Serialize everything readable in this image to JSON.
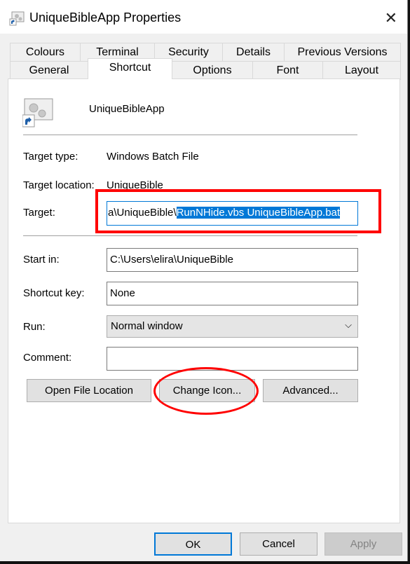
{
  "window": {
    "title": "UniqueBibleApp Properties"
  },
  "tabs_row1": [
    "Colours",
    "Terminal",
    "Security",
    "Details",
    "Previous Versions"
  ],
  "tabs_row2": [
    "General",
    "Shortcut",
    "Options",
    "Font",
    "Layout"
  ],
  "shortcut": {
    "name": "UniqueBibleApp",
    "target_type_label": "Target type:",
    "target_type": "Windows Batch File",
    "target_location_label": "Target location:",
    "target_location": "UniqueBible",
    "target_label": "Target:",
    "target_prefix": "a\\UniqueBible\\",
    "target_selected": "RunNHide.vbs UniqueBibleApp.bat",
    "start_in_label": "Start in:",
    "start_in": "C:\\Users\\elira\\UniqueBible",
    "shortcut_key_label": "Shortcut key:",
    "shortcut_key": "None",
    "run_label": "Run:",
    "run": "Normal window",
    "comment_label": "Comment:",
    "comment": "",
    "open_file_location": "Open File Location",
    "change_icon": "Change Icon...",
    "advanced": "Advanced..."
  },
  "footer": {
    "ok": "OK",
    "cancel": "Cancel",
    "apply": "Apply"
  },
  "colors": {
    "annotation": "#ff0000",
    "selection": "#0078d7"
  }
}
